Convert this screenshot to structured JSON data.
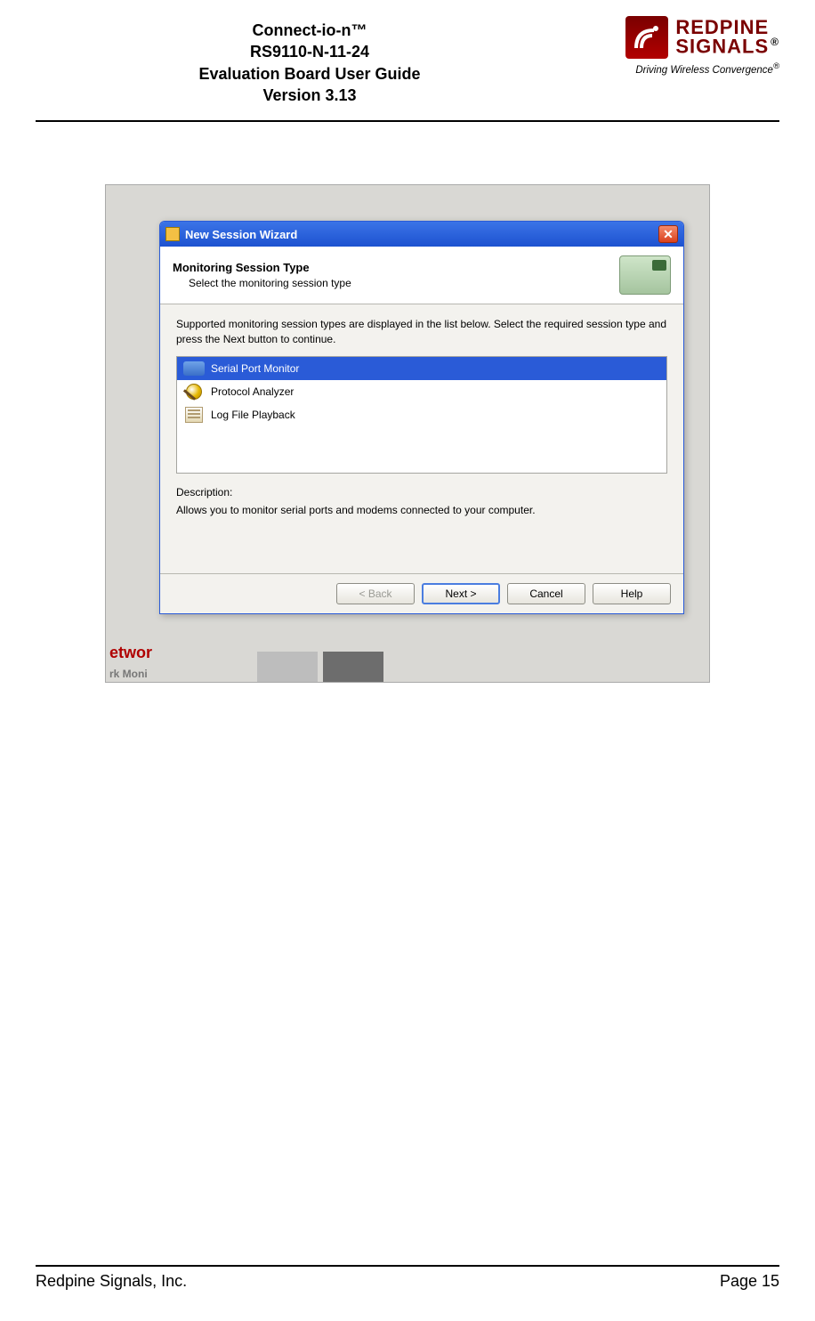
{
  "header": {
    "product": "Connect-io-n™",
    "model": "RS9110-N-11-24",
    "guide": "Evaluation Board User Guide",
    "version": "Version 3.13",
    "logo_top": "REDPINE",
    "logo_bottom": "SIGNALS",
    "registered": "®",
    "tagline": "Driving Wireless Convergence",
    "tagline_sup": "®"
  },
  "dialog": {
    "titlebar": "New Session Wizard",
    "head_title": "Monitoring Session Type",
    "head_sub": "Select the monitoring session type",
    "instruction": "Supported monitoring session types are displayed in the list below. Select the required session type and press the Next button to continue.",
    "items": [
      {
        "label": "Serial Port Monitor",
        "selected": true
      },
      {
        "label": "Protocol Analyzer",
        "selected": false
      },
      {
        "label": "Log File Playback",
        "selected": false
      }
    ],
    "desc_label": "Description:",
    "desc_text": "Allows you to monitor serial ports and modems connected to your computer.",
    "buttons": {
      "back": "< Back",
      "next": "Next >",
      "cancel": "Cancel",
      "help": "Help"
    }
  },
  "background": {
    "frag1": "etwor",
    "frag2": "rk Moni"
  },
  "footer": {
    "company": "Redpine Signals, Inc.",
    "page": "Page 15"
  }
}
